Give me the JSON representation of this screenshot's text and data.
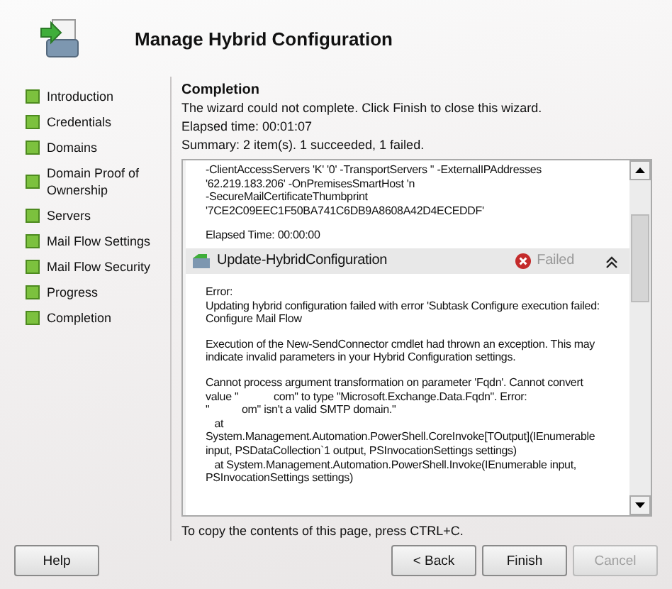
{
  "header": {
    "title": "Manage Hybrid Configuration"
  },
  "steps": [
    {
      "label": "Introduction"
    },
    {
      "label": "Credentials"
    },
    {
      "label": "Domains"
    },
    {
      "label": "Domain Proof of Ownership"
    },
    {
      "label": "Servers"
    },
    {
      "label": "Mail Flow Settings"
    },
    {
      "label": "Mail Flow Security"
    },
    {
      "label": "Progress"
    },
    {
      "label": "Completion"
    }
  ],
  "content": {
    "heading": "Completion",
    "message": "The wizard could not complete. Click Finish to close this wizard.",
    "elapsed": "Elapsed time: 00:01:07",
    "summary": "Summary: 2 item(s). 1 succeeded, 1 failed."
  },
  "log": {
    "previous_lines": "-ClientAccessServers 'K' '0' -TransportServers '' -ExternalIPAddresses\n'62.219.183.206' -OnPremisesSmartHost 'n\n-SecureMailCertificateThumbprint\n'7CE2C09EEC1F50BA741C6DB9A8608A42D4ECEDDF'",
    "previous_elapsed": "Elapsed Time: 00:00:00",
    "task": {
      "name": "Update-HybridConfiguration",
      "status": "Failed",
      "expanded": true
    },
    "paragraphs": [
      "Error:\nUpdating hybrid configuration failed with error 'Subtask Configure execution failed:\nConfigure Mail Flow",
      "Execution of the New-SendConnector cmdlet had thrown an exception. This may\nindicate invalid parameters in your Hybrid Configuration settings.",
      "Cannot process argument transformation on parameter 'Fqdn'. Cannot convert\nvalue \"            com\" to type \"Microsoft.Exchange.Data.Fqdn\". Error:\n\"           om\" isn't a valid SMTP domain.\"\n   at\nSystem.Management.Automation.PowerShell.CoreInvoke[TOutput](IEnumerable\ninput, PSDataCollection`1 output, PSInvocationSettings settings)\n   at System.Management.Automation.PowerShell.Invoke(IEnumerable input,\nPSInvocationSettings settings)"
    ]
  },
  "footer_note": "To copy the contents of this page, press CTRL+C.",
  "help_button": {
    "label": "Help",
    "disabled": false
  },
  "buttons": [
    {
      "label": "< Back",
      "disabled": false
    },
    {
      "label": "Finish",
      "disabled": false
    },
    {
      "label": "Cancel",
      "disabled": true
    }
  ]
}
